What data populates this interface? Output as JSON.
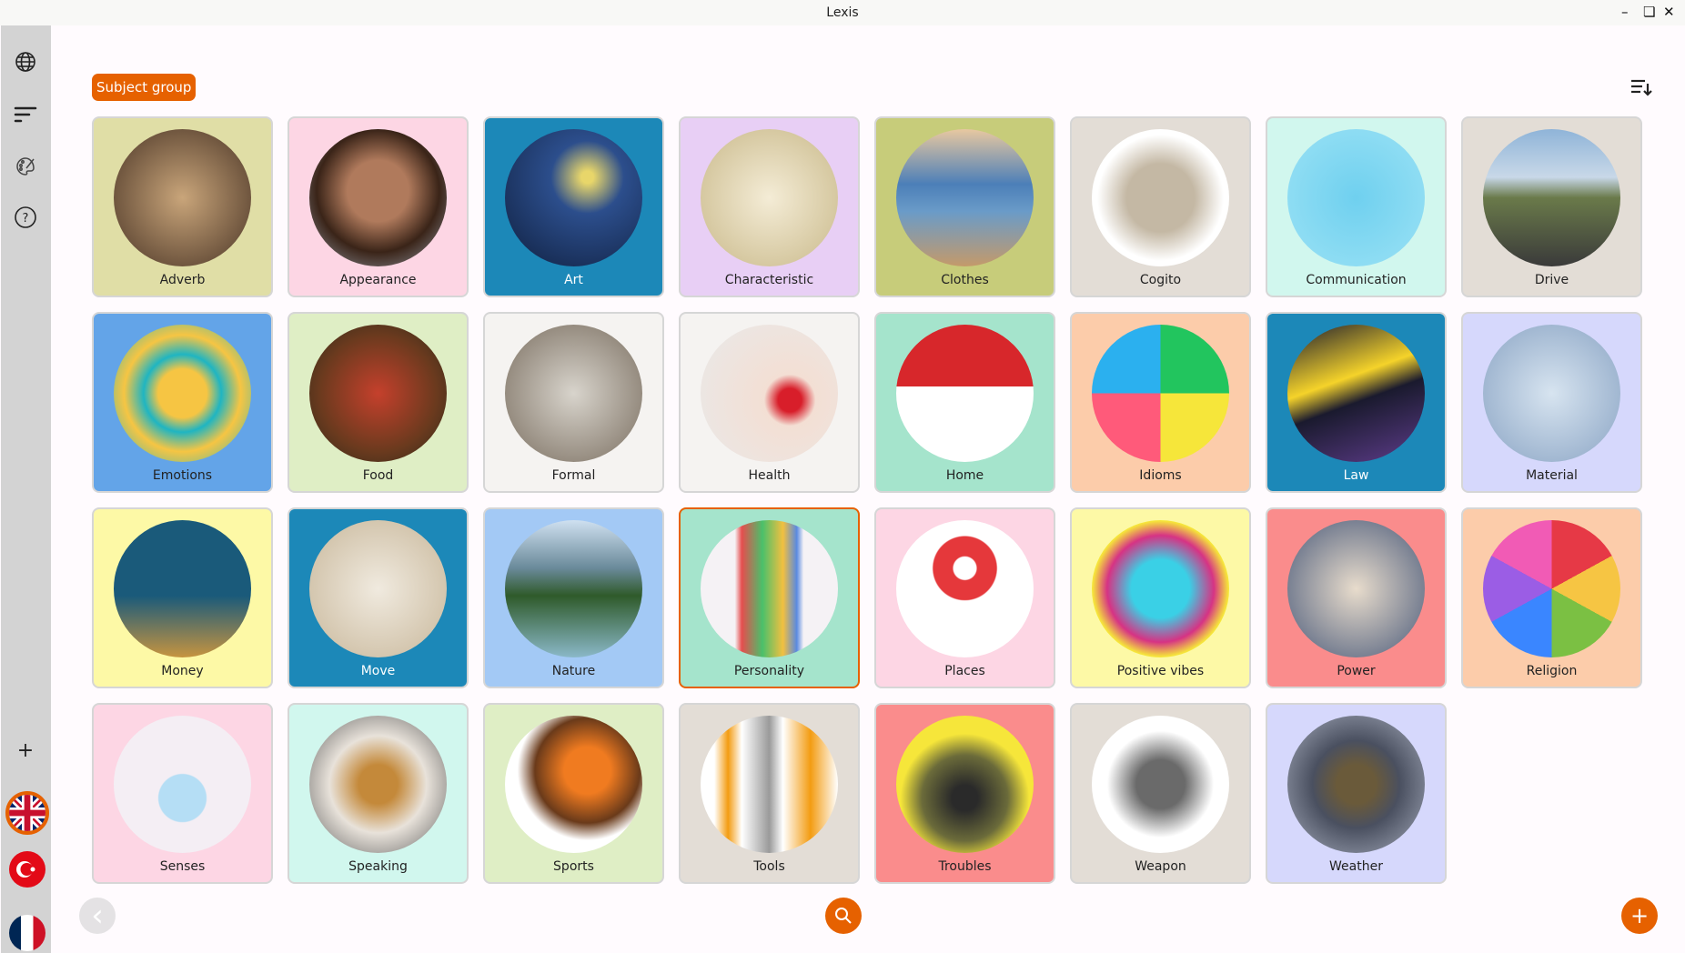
{
  "window": {
    "title": "Lexis",
    "minimize": "–",
    "restore": "❏",
    "close": "✕"
  },
  "sidebar": {
    "icons": [
      "globe-icon",
      "filter-lines-icon",
      "palette-icon",
      "help-icon"
    ],
    "add_label": "+",
    "languages": [
      "English",
      "Turkish",
      "French"
    ]
  },
  "header": {
    "chip_label": "Subject group"
  },
  "colors": {
    "accent": "#e66100"
  },
  "cards": [
    {
      "label": "Adverb",
      "bg": "#e0dea6",
      "img": "radial-gradient(circle,#c9a57a,#4a3526)"
    },
    {
      "label": "Appearance",
      "bg": "#fdd6e4",
      "img": "radial-gradient(circle at 50% 45%,#b07a5c 30%,#3a2418 60%,#9aa3b0)"
    },
    {
      "label": "Art",
      "bg": "#1c88b8",
      "dark": true,
      "img": "radial-gradient(circle at 60% 35%,#e8d66a 5%,#2c4e8c 30%,#0f1f3e)"
    },
    {
      "label": "Characteristic",
      "bg": "#e8cff5",
      "img": "radial-gradient(circle,#f4ecd6,#c9b98a)"
    },
    {
      "label": "Clothes",
      "bg": "#c7cc7a",
      "img": "linear-gradient(#e8c8a0,#4c7fb8 40%,#6a9bc8 60%,#c49a6a)"
    },
    {
      "label": "Cogito",
      "bg": "#e3ddd6",
      "img": "radial-gradient(circle,#c4b8a4 35%,#fff 65%)"
    },
    {
      "label": "Communication",
      "bg": "#d1f7ee",
      "img": "radial-gradient(circle,#6fd0ef,#9be2f5)"
    },
    {
      "label": "Drive",
      "bg": "#e3ddd6",
      "img": "linear-gradient(#8fb4d8,#c8d8e8 35%,#6a7a4a 50%,#3a3a3a)"
    },
    {
      "label": "Emotions",
      "bg": "#63a4e8",
      "img": "radial-gradient(circle,#f6c543 25%,#1fb5c2 40%,#f6c543 60%,#1fb5c2)"
    },
    {
      "label": "Food",
      "bg": "#dfeec5",
      "img": "radial-gradient(circle,#c5402c,#6b3a1e 60%,#2c2a1a)"
    },
    {
      "label": "Formal",
      "bg": "#f5f3f1",
      "img": "radial-gradient(circle,#d8d4cc,#7a6e60)"
    },
    {
      "label": "Health",
      "bg": "#f5f3f1",
      "img": "radial-gradient(circle at 65% 55%,#d81e2a 10%,#f3dfd4 22%,#e9e9e9)"
    },
    {
      "label": "Home",
      "bg": "#a5e4cc",
      "img": "linear-gradient(#d7272b 45%,#fff 45%)"
    },
    {
      "label": "Idioms",
      "bg": "#fcccaa",
      "img": "conic-gradient(#22c55e 0 25%,#f6e63a 0 50%,#ff5a7a 0 75%,#2bb0ef 0)"
    },
    {
      "label": "Law",
      "bg": "#1c88b8",
      "dark": true,
      "img": "linear-gradient(160deg,#1a1a2e,#f5d32a 40%,#1a1a2e 55%,#5d3c8a)"
    },
    {
      "label": "Material",
      "bg": "#d6d8fc",
      "img": "radial-gradient(circle,#d7e4f0,#8aa4c4)"
    },
    {
      "label": "Money",
      "bg": "#fdf9a6",
      "img": "linear-gradient(#1a5a7a 55%,#c69440)"
    },
    {
      "label": "Move",
      "bg": "#1c88b8",
      "dark": true,
      "img": "radial-gradient(circle,#f0eadf,#c8b79a)"
    },
    {
      "label": "Nature",
      "bg": "#a3c9f5",
      "img": "linear-gradient(#cfe0f0,#6a8a9a 35%,#2f5a2a 55%,#8ab8c8)"
    },
    {
      "label": "Personality",
      "bg": "#a5e4cc",
      "sel": true,
      "img": "linear-gradient(90deg,#f5f2f5 25%,#e54e4e 30%,#4ac06a 45%,#f2c040 60%,#5a8ae0 70%,#f5f2f5 75%)"
    },
    {
      "label": "Places",
      "bg": "#fdd6e4",
      "img": "radial-gradient(circle at 50% 35%,#fff 10%,#e5383b 11%,#e5383b 28%,#fff 29%)"
    },
    {
      "label": "Positive vibes",
      "bg": "#fdf9a6",
      "img": "radial-gradient(circle,#3ad0e6 30%,#d63384 55%,#f6e63a 70%)"
    },
    {
      "label": "Power",
      "bg": "#fa8c8c",
      "img": "radial-gradient(circle,#e8dccc,#4a5a7a)"
    },
    {
      "label": "Religion",
      "bg": "#fcccaa",
      "img": "conic-gradient(#e63946 0 17%,#f6c543 0 33%,#7bc043 0 50%,#3a86ff 0 67%,#9b5de5 0 83%,#f15bb5 0)"
    },
    {
      "label": "Senses",
      "bg": "#fdd6e4",
      "img": "radial-gradient(circle at 50% 60%,#b5def5 22%,#f4eef4 23%)"
    },
    {
      "label": "Speaking",
      "bg": "#d1f7ee",
      "img": "radial-gradient(circle,#c4893a 20%,#e8e2da 50%,#5a5a5a)"
    },
    {
      "label": "Sports",
      "bg": "#dfeec5",
      "img": "radial-gradient(circle at 60% 40%,#f07b20 20%,#6a3a1a 45%,#fff 60%)"
    },
    {
      "label": "Tools",
      "bg": "#e3ddd6",
      "img": "linear-gradient(90deg,#fff 10%,#f39c12 20%,#fff 30%,#9a9a9a 50%,#fff 60%,#f39c12 80%,#fff)"
    },
    {
      "label": "Troubles",
      "bg": "#fa8c8c",
      "img": "radial-gradient(circle at 50% 60%,#2a2a2a 12%,#6b6b3a 40%,#f6e63a 60%)"
    },
    {
      "label": "Weapon",
      "bg": "#e3ddd6",
      "img": "radial-gradient(circle,#6a6a6a 25%,#fff 55%)"
    },
    {
      "label": "Weather",
      "bg": "#d6d8fc",
      "img": "radial-gradient(ellipse,#6a5a3a 20%,#4a5060 45%,#aab0c0)"
    }
  ],
  "footer": {
    "back_icon": "‹",
    "search_icon": "search-icon",
    "add_icon": "+"
  }
}
